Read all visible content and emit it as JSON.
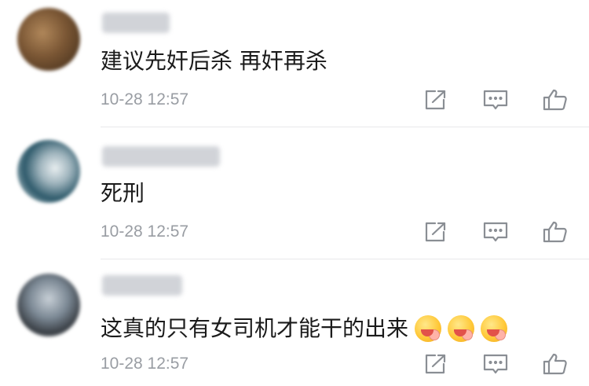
{
  "comments": [
    {
      "text": "建议先奸后杀 再奸再杀",
      "time": "10-28 12:57"
    },
    {
      "text": "死刑",
      "time": "10-28 12:57"
    },
    {
      "text": "这真的只有女司机才能干的出来",
      "time": "10-28 12:57",
      "emojis": [
        "yummy-face-emoji",
        "yummy-face-emoji",
        "yummy-face-emoji"
      ]
    }
  ],
  "colors": {
    "text": "#1b1b1b",
    "meta": "#999da3",
    "icon": "#8a8e94",
    "divider": "#e8e8ea"
  }
}
